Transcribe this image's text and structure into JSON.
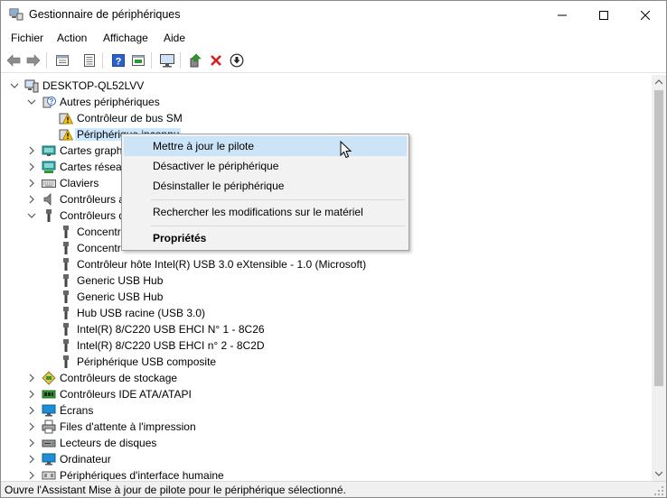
{
  "window": {
    "title": "Gestionnaire de périphériques"
  },
  "menubar": {
    "items": [
      "Fichier",
      "Action",
      "Affichage",
      "Aide"
    ]
  },
  "toolbar": {
    "icons": [
      "back-arrow-icon",
      "forward-arrow-icon",
      "properties-view-icon",
      "list-view-icon",
      "help-icon",
      "update-panel-icon",
      "monitor-scan-icon",
      "add-driver-icon",
      "remove-x-icon",
      "download-circle-icon"
    ],
    "accent_colors": {
      "red": "#d91e18",
      "green": "#2e9a2e",
      "blue": "#2a62c9"
    }
  },
  "tree": {
    "root": "DESKTOP-QL52LVV",
    "nodes": [
      {
        "label": "Autres périphériques",
        "expanded": true,
        "children": [
          "Contrôleur de bus SM",
          "Périphérique inconnu"
        ]
      },
      {
        "label": "Cartes graph",
        "expanded": false
      },
      {
        "label": "Cartes réseau",
        "expanded": false
      },
      {
        "label": "Claviers",
        "expanded": false
      },
      {
        "label": "Contrôleurs a",
        "expanded": false
      },
      {
        "label": "Contrôleurs de bus USB",
        "expanded": true,
        "children": [
          "Concentr",
          "Concentr",
          "Contrôleur hôte Intel(R) USB 3.0 eXtensible - 1.0 (Microsoft)",
          "Generic USB Hub",
          "Generic USB Hub",
          "Hub USB racine (USB 3.0)",
          "Intel(R) 8/C220 USB EHCI N° 1 - 8C26",
          "Intel(R) 8/C220 USB EHCI n° 2 - 8C2D",
          "Périphérique USB composite"
        ]
      },
      {
        "label": "Contrôleurs de stockage",
        "expanded": false
      },
      {
        "label": "Contrôleurs IDE ATA/ATAPI",
        "expanded": false
      },
      {
        "label": "Écrans",
        "expanded": false
      },
      {
        "label": "Files d'attente à l'impression",
        "expanded": false
      },
      {
        "label": "Lecteurs de disques",
        "expanded": false
      },
      {
        "label": "Ordinateur",
        "expanded": false
      },
      {
        "label": "Périphériques d'interface humaine",
        "expanded": false
      }
    ]
  },
  "context_menu": {
    "items": [
      {
        "label": "Mettre à jour le pilote",
        "highlighted": true
      },
      {
        "label": "Désactiver le périphérique"
      },
      {
        "label": "Désinstaller le périphérique"
      },
      {
        "label": "Rechercher les modifications sur le matériel"
      },
      {
        "label": "Propriétés",
        "bold": true
      }
    ]
  },
  "statusbar": {
    "text": "Ouvre l'Assistant Mise à jour de pilote pour le périphérique sélectionné."
  }
}
